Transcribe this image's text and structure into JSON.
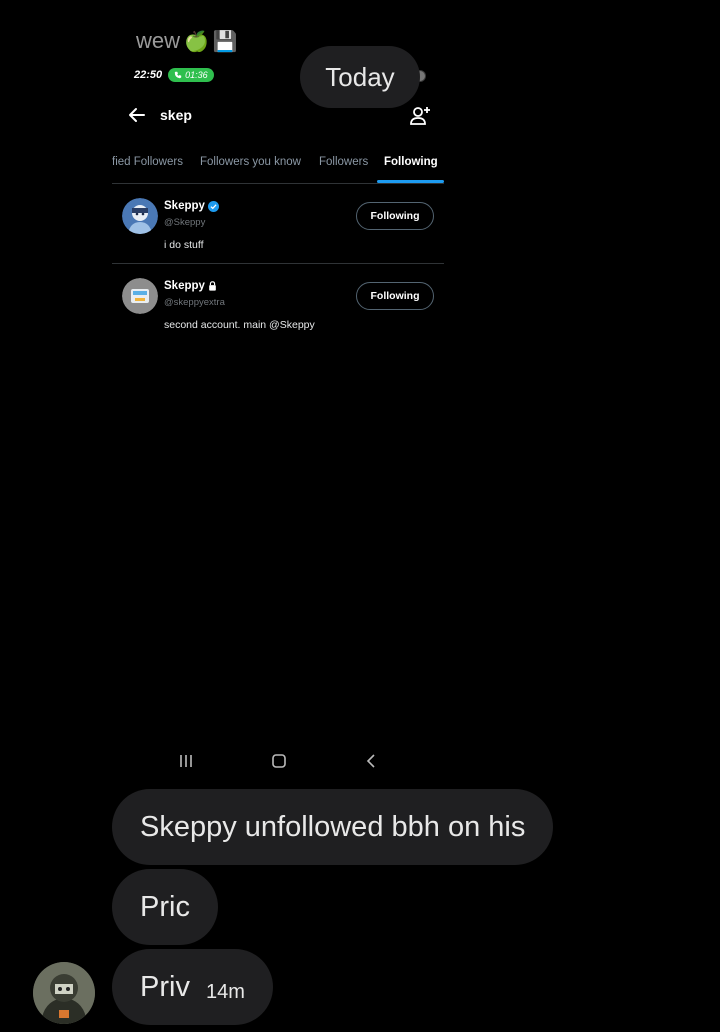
{
  "caption": {
    "text": "wew",
    "emojis": [
      "🍏",
      "💾"
    ]
  },
  "date_divider": "Today",
  "screenshot": {
    "status_bar": {
      "time": "22:50",
      "call_duration": "01:36"
    },
    "header": {
      "title": "skep"
    },
    "tabs": [
      {
        "label": "fied Followers",
        "active": false
      },
      {
        "label": "Followers you know",
        "active": false
      },
      {
        "label": "Followers",
        "active": false
      },
      {
        "label": "Following",
        "active": true
      }
    ],
    "users": [
      {
        "name": "Skeppy",
        "badge": "verified",
        "handle": "@Skeppy",
        "bio": "i do stuff",
        "button": "Following"
      },
      {
        "name": "Skeppy",
        "badge": "locked",
        "handle": "@skeppyextra",
        "bio": "second account. main @Skeppy",
        "button": "Following"
      }
    ],
    "colors": {
      "accent": "#1d9bf0",
      "call_green": "#2fbf4e",
      "background": "#000000"
    }
  },
  "messages": [
    {
      "text": "Skeppy unfollowed bbh on his",
      "timestamp": ""
    },
    {
      "text": "Pric",
      "timestamp": ""
    },
    {
      "text": "Priv",
      "timestamp": "14m"
    }
  ]
}
